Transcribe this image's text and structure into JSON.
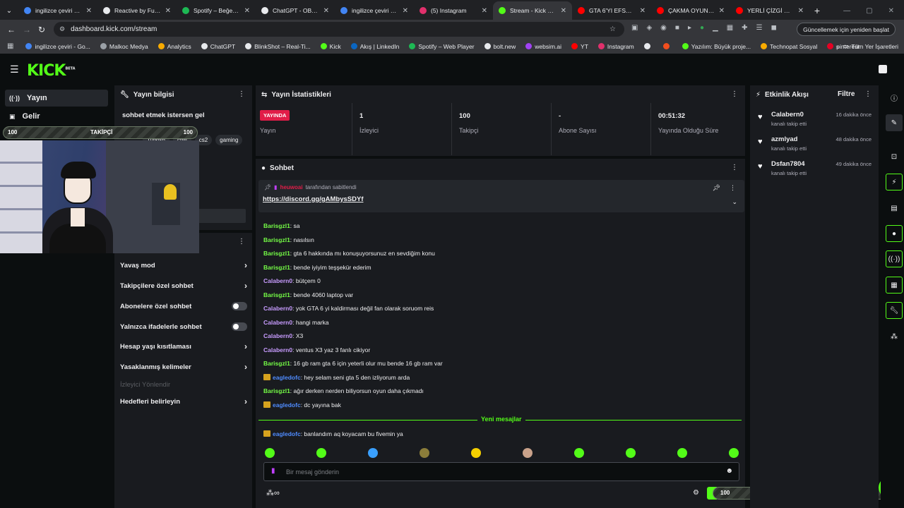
{
  "browser": {
    "tabs": [
      {
        "title": "ingilizce çeviri - Go",
        "color": "#4285f4"
      },
      {
        "title": "Reactive by FugiTec",
        "color": "#e8eaed"
      },
      {
        "title": "Spotify – Beğenilen",
        "color": "#1db954"
      },
      {
        "title": "ChatGPT - OBS EKR",
        "color": "#e8eaed"
      },
      {
        "title": "ingilizce çeviri - Go",
        "color": "#4285f4"
      },
      {
        "title": "(5) Instagram",
        "color": "#e1306c"
      },
      {
        "title": "Stream - Kick Dashb",
        "color": "#53fc18"
      },
      {
        "title": "GTA 6'YI EFSANELEŞ",
        "color": "#ff0000"
      },
      {
        "title": "ÇAKMA OYUN SLITH",
        "color": "#ff0000"
      },
      {
        "title": "YERLİ ÇİZGİ DİZİLER",
        "color": "#ff0000"
      }
    ],
    "url": "dashboard.kick.com/stream",
    "update_label": "Güncellemek için yeniden başlat",
    "bookmarks": [
      {
        "label": "ingilizce çeviri - Go...",
        "color": "#4285f4"
      },
      {
        "label": "Malkoc Medya",
        "color": "#9aa0a6"
      },
      {
        "label": "Analytics",
        "color": "#f9ab00"
      },
      {
        "label": "ChatGPT",
        "color": "#e8eaed"
      },
      {
        "label": "BlinkShot – Real-Ti...",
        "color": "#e8eaed"
      },
      {
        "label": "Kick",
        "color": "#53fc18"
      },
      {
        "label": "Akış | LinkedIn",
        "color": "#0a66c2"
      },
      {
        "label": "Spotify – Web Player",
        "color": "#1db954"
      },
      {
        "label": "bolt.new",
        "color": "#e8eaed"
      },
      {
        "label": "websim.ai",
        "color": "#a142f4"
      },
      {
        "label": "YT",
        "color": "#ff0000"
      },
      {
        "label": "Instagram",
        "color": "#e1306c"
      },
      {
        "label": "",
        "color": "#e8eaed"
      },
      {
        "label": "",
        "color": "#f24e1e"
      },
      {
        "label": "Yazılım: Büyük proje...",
        "color": "#53fc18"
      },
      {
        "label": "Technopat Sosyal",
        "color": "#f9ab00"
      },
      {
        "label": "pinterest",
        "color": "#e60023"
      }
    ],
    "all_bookmarks": "Tüm Yer İşaretleri"
  },
  "nav": {
    "items": [
      {
        "label": "Yayın",
        "icon": "broadcast-icon"
      },
      {
        "label": "Gelir",
        "icon": "wallet-icon"
      }
    ]
  },
  "stream_info": {
    "title": "Yayın bilgisi",
    "stream_title": "sohbet etmek istersen gel",
    "tags": [
      "Turkish",
      "chill",
      "cs2",
      "gaming"
    ]
  },
  "chat_settings": {
    "items": [
      {
        "label": "Yavaş mod",
        "control": "chevron"
      },
      {
        "label": "Takipçilere özel sohbet",
        "control": "chevron"
      },
      {
        "label": "Abonelere özel sohbet",
        "control": "toggle"
      },
      {
        "label": "Yalnızca ifadelerle sohbet",
        "control": "toggle"
      },
      {
        "label": "Hesap yaşı kısıtlaması",
        "control": "chevron"
      },
      {
        "label": "Yasaklanmış kelimeler",
        "control": "chevron"
      },
      {
        "label": "İzleyici Yönlendir",
        "control": "disabled"
      },
      {
        "label": "Hedefleri belirleyin",
        "control": "chevron"
      }
    ]
  },
  "stats": {
    "title": "Yayın İstatistikleri",
    "live_badge": "YAYINDA",
    "cells": [
      {
        "value": "",
        "label": "Yayın"
      },
      {
        "value": "1",
        "label": "İzleyici"
      },
      {
        "value": "100",
        "label": "Takipçi"
      },
      {
        "value": "-",
        "label": "Abone Sayısı"
      },
      {
        "value": "00:51:32",
        "label": "Yayında Olduğu Süre"
      }
    ]
  },
  "chat": {
    "title": "Sohbet",
    "pinned_by": "heuwoai",
    "pinned_suffix": "tarafından sabitlendi",
    "pinned_link": "https://discord.gg/gAMbysSDYf",
    "messages": [
      {
        "user": "Barisgzl1",
        "text": "sa",
        "color": "u-mint",
        "crown": false
      },
      {
        "user": "Barisgzl1",
        "text": "nasılsın",
        "color": "u-mint",
        "crown": false
      },
      {
        "user": "Barisgzl1",
        "text": "gta 6 hakkında mı konuşuyorsunuz en sevdiğim konu",
        "color": "u-mint",
        "crown": false
      },
      {
        "user": "Barisgzl1",
        "text": "bende iyiyim teşşekür ederim",
        "color": "u-mint",
        "crown": false
      },
      {
        "user": "Calabern0",
        "text": "bütçem 0",
        "color": "u-purple",
        "crown": false
      },
      {
        "user": "Barisgzl1",
        "text": "bende 4060 laptop var",
        "color": "u-mint",
        "crown": false
      },
      {
        "user": "Calabern0",
        "text": "yok GTA 6 yi kaldirması değil fan olarak soruom reis",
        "color": "u-purple",
        "crown": false
      },
      {
        "user": "Calabern0",
        "text": "hangi marka",
        "color": "u-purple",
        "crown": false
      },
      {
        "user": "Calabern0",
        "text": "X3",
        "color": "u-purple",
        "crown": false
      },
      {
        "user": "Calabern0",
        "text": "ventus X3 yaz 3 fanlı cikiyor",
        "color": "u-purple",
        "crown": false
      },
      {
        "user": "Barisgzl1",
        "text": "16 gb ram gta 6 için yeterli olur mu bende 16 gb ram var",
        "color": "u-mint",
        "crown": false
      },
      {
        "user": "eagledofc",
        "text": "hey selam seni gta 5 den izliyorum arda",
        "color": "u-blue",
        "crown": true
      },
      {
        "user": "Barisgzl1",
        "text": "ağır derken nerden biliyorsun oyun daha çıkmadı",
        "color": "u-mint",
        "crown": false
      },
      {
        "user": "eagledofc",
        "text": "dc yayına bak",
        "color": "u-blue",
        "crown": true
      }
    ],
    "new_messages_label": "Yeni mesajlar",
    "after_new": {
      "user": "eagledofc",
      "text": "banlandım aq koyacam bu fivemin ya",
      "color": "u-blue",
      "crown": true
    },
    "input_placeholder": "Bir mesaj gönderin"
  },
  "activity": {
    "title": "Etkinlik Akışı",
    "filter": "Filtre",
    "items": [
      {
        "name": "Calabern0",
        "sub": "kanalı takip etti",
        "time": "16 dakika önce"
      },
      {
        "name": "azmlyad",
        "sub": "kanalı takip etti",
        "time": "48 dakika önce"
      },
      {
        "name": "Dsfan7804",
        "sub": "kanalı takip etti",
        "time": "49 dakika önce"
      }
    ]
  },
  "follower_widget": {
    "left": "100",
    "center": "TAKİPÇİ",
    "right": "100"
  },
  "colors": {
    "brand": "#53fc18",
    "live": "#e11d48",
    "panel": "#191b1f"
  }
}
